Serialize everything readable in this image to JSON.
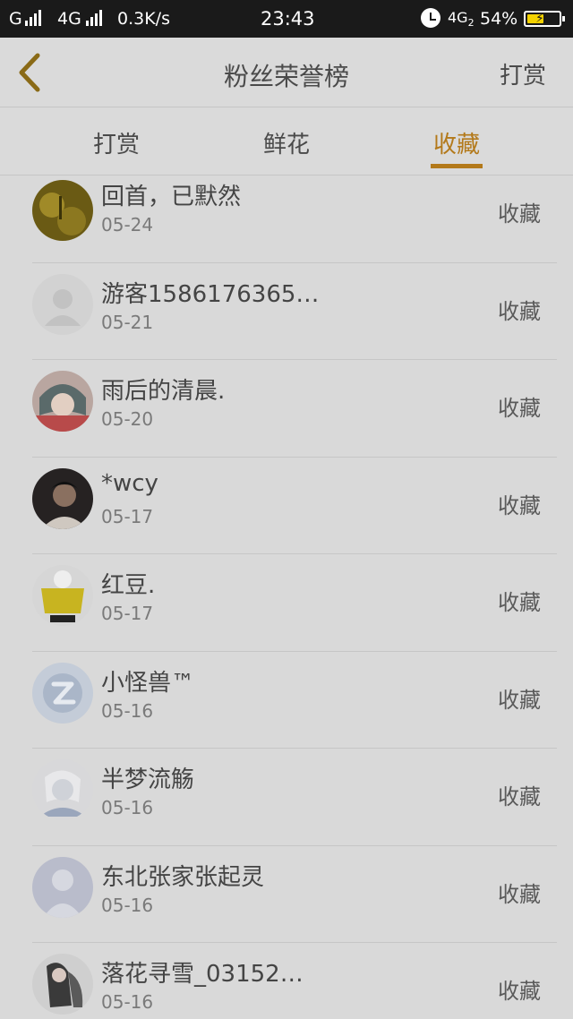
{
  "status_bar": {
    "carrier": "G",
    "network": "4G",
    "speed": "0.3K/s",
    "time": "23:43",
    "network2": "4G",
    "network2_sub": "2",
    "battery": "54%",
    "battery_level": 0.54,
    "battery_color": "#f4d200"
  },
  "nav": {
    "title": "粉丝荣誉榜",
    "action": "打赏"
  },
  "tabs": [
    {
      "label": "打赏"
    },
    {
      "label": "鲜花"
    },
    {
      "label": "收藏"
    }
  ],
  "accent_color": "#b3791a",
  "fans": [
    {
      "name": "回首，已默然",
      "date": "05-24",
      "action": "收藏"
    },
    {
      "name": "游客1586176365…",
      "date": "05-21",
      "action": "收藏"
    },
    {
      "name": "雨后的清晨.",
      "date": "05-20",
      "action": "收藏"
    },
    {
      "name": "*wcy",
      "date": "05-17",
      "action": "收藏"
    },
    {
      "name": "红豆.",
      "date": "05-17",
      "action": "收藏"
    },
    {
      "name": "小怪兽™",
      "date": "05-16",
      "action": "收藏"
    },
    {
      "name": "半梦流觞",
      "date": "05-16",
      "action": "收藏"
    },
    {
      "name": "东北张家张起灵",
      "date": "05-16",
      "action": "收藏"
    },
    {
      "name": "落花寻雪_03152…",
      "date": "05-16",
      "action": "收藏"
    }
  ]
}
